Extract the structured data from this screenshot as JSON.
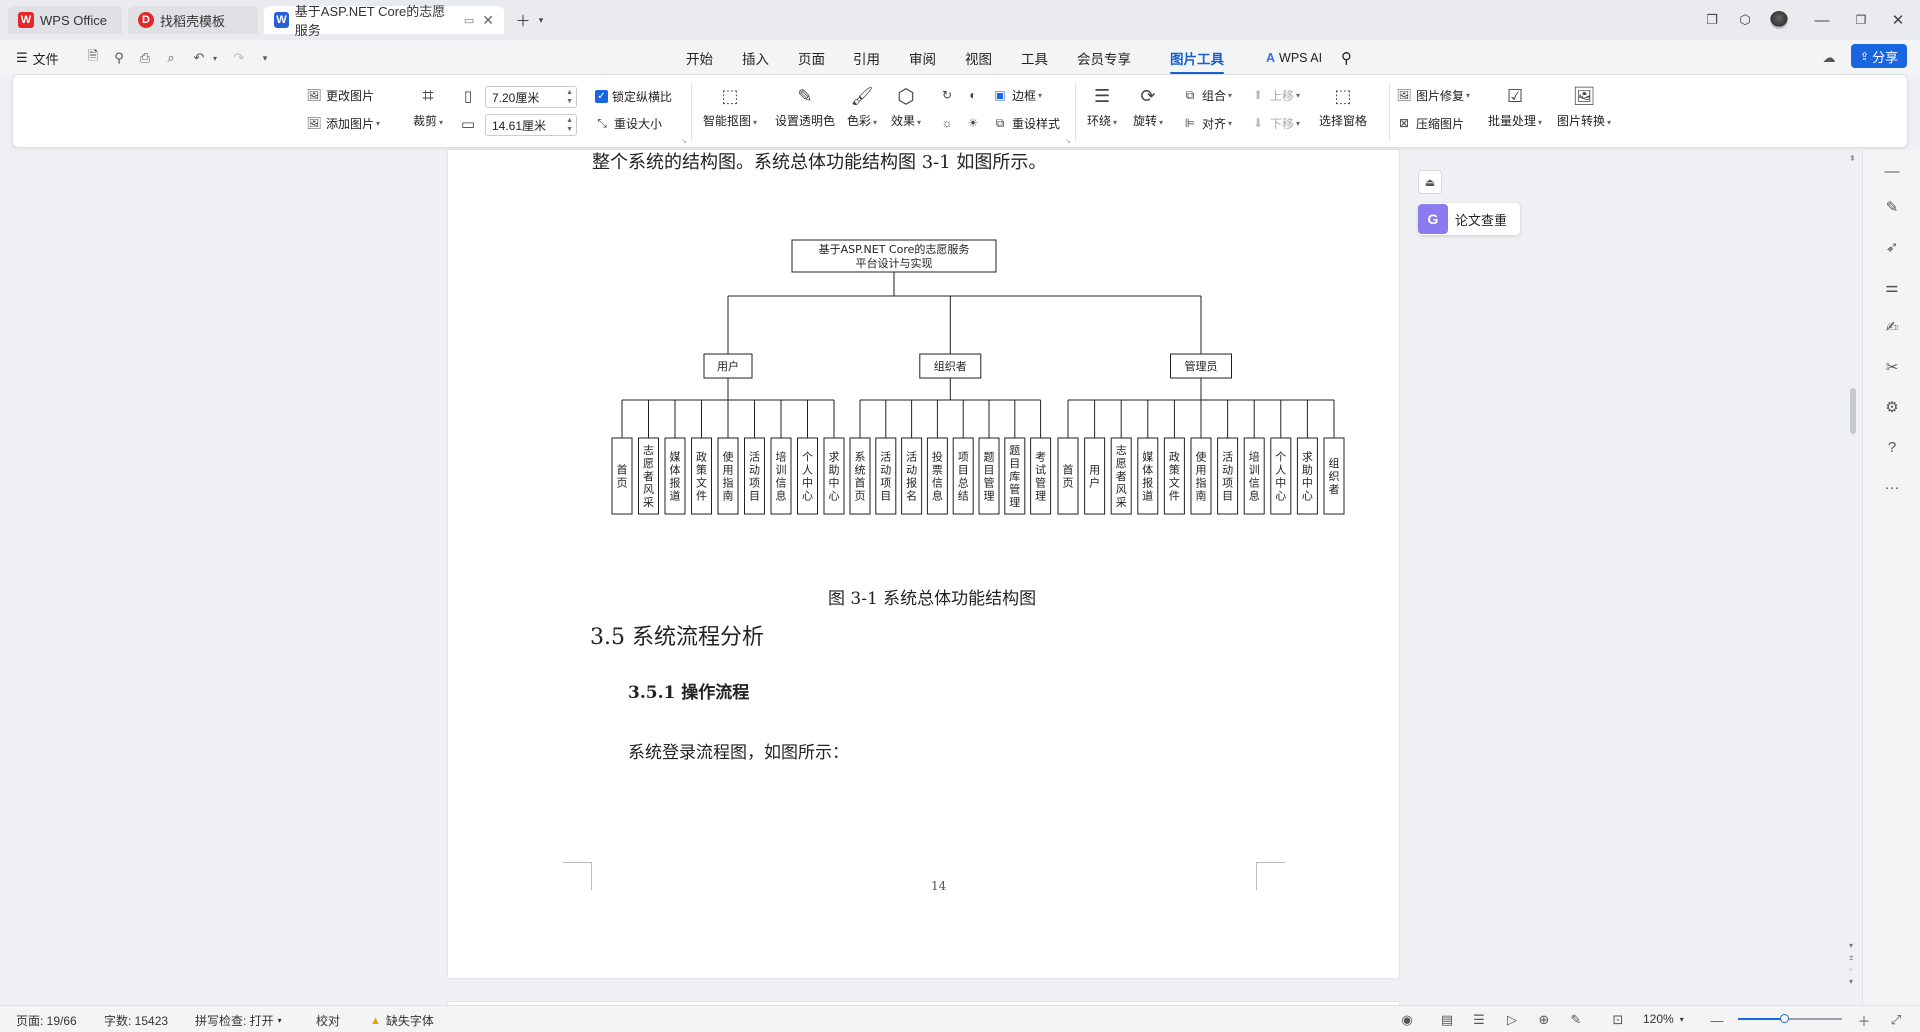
{
  "tabs": [
    {
      "label": "WPS Office",
      "icon": "wps-logo-icon"
    },
    {
      "label": "找稻壳模板",
      "icon": "docer-icon"
    },
    {
      "label": "基于ASP.NET Core的志愿服务",
      "icon": "word-doc-icon"
    }
  ],
  "menubar": {
    "file_label": "文件",
    "tabs": [
      "开始",
      "插入",
      "页面",
      "引用",
      "审阅",
      "视图",
      "工具",
      "会员专享",
      "图片工具"
    ],
    "active_tab": "图片工具",
    "wps_ai": "WPS AI",
    "share": "分享"
  },
  "ribbon": {
    "change_picture": "更改图片",
    "add_picture": "添加图片",
    "crop": "裁剪",
    "width": "7.20厘米",
    "height": "14.61厘米",
    "lock_ratio": "锁定纵横比",
    "reset_size": "重设大小",
    "smart_cutout": "智能抠图",
    "set_transparent": "设置透明色",
    "color": "色彩",
    "effects": "效果",
    "border": "边框",
    "reset_style": "重设样式",
    "wrap": "环绕",
    "rotate": "旋转",
    "group": "组合",
    "align": "对齐",
    "move_up": "上移",
    "move_down": "下移",
    "selection_pane": "选择窗格",
    "picture_repair": "图片修复",
    "compress_picture": "压缩图片",
    "batch_process": "批量处理",
    "picture_convert": "图片转换"
  },
  "document": {
    "top_line": "整个系统的结构图。系统总体功能结构图 3-1 如图所示。",
    "caption": "图 3-1 系统总体功能结构图",
    "heading": "3.5 系统流程分析",
    "subheading": "3.5.1 操作流程",
    "paragraph": "系统登录流程图，如图所示：",
    "page_number": "14"
  },
  "chart_data": {
    "type": "table",
    "root": "基于ASP.NET Core的志愿服务平台设计与实现",
    "root_lines": [
      "基于ASP.NET Core的志愿服务",
      "平台设计与实现"
    ],
    "groups": [
      {
        "name": "用户",
        "children": [
          "首页",
          "志愿者风采",
          "媒体报道",
          "政策文件",
          "使用指南",
          "活动项目",
          "培训信息",
          "个人中心",
          "求助中心"
        ]
      },
      {
        "name": "组织者",
        "children": [
          "系统首页",
          "活动项目",
          "活动报名",
          "投票信息",
          "项目总结",
          "题目管理",
          "题目库管理",
          "考试管理"
        ]
      },
      {
        "name": "管理员",
        "children": [
          "首页",
          "用户",
          "志愿者风采",
          "媒体报道",
          "政策文件",
          "使用指南",
          "活动项目",
          "培训信息",
          "个人中心",
          "求助中心",
          "组织者"
        ]
      }
    ]
  },
  "side_panel": {
    "plagiarism": "论文查重"
  },
  "statusbar": {
    "page": "页面: 19/66",
    "words": "字数: 15423",
    "spellcheck": "拼写检查: 打开",
    "proofread": "校对",
    "missing_font": "缺失字体",
    "zoom": "120%",
    "zoom_fraction": 0.45
  },
  "colors": {
    "accent": "#1a66e0",
    "wps_red": "#e5262b",
    "word_blue": "#2b5fd9"
  }
}
